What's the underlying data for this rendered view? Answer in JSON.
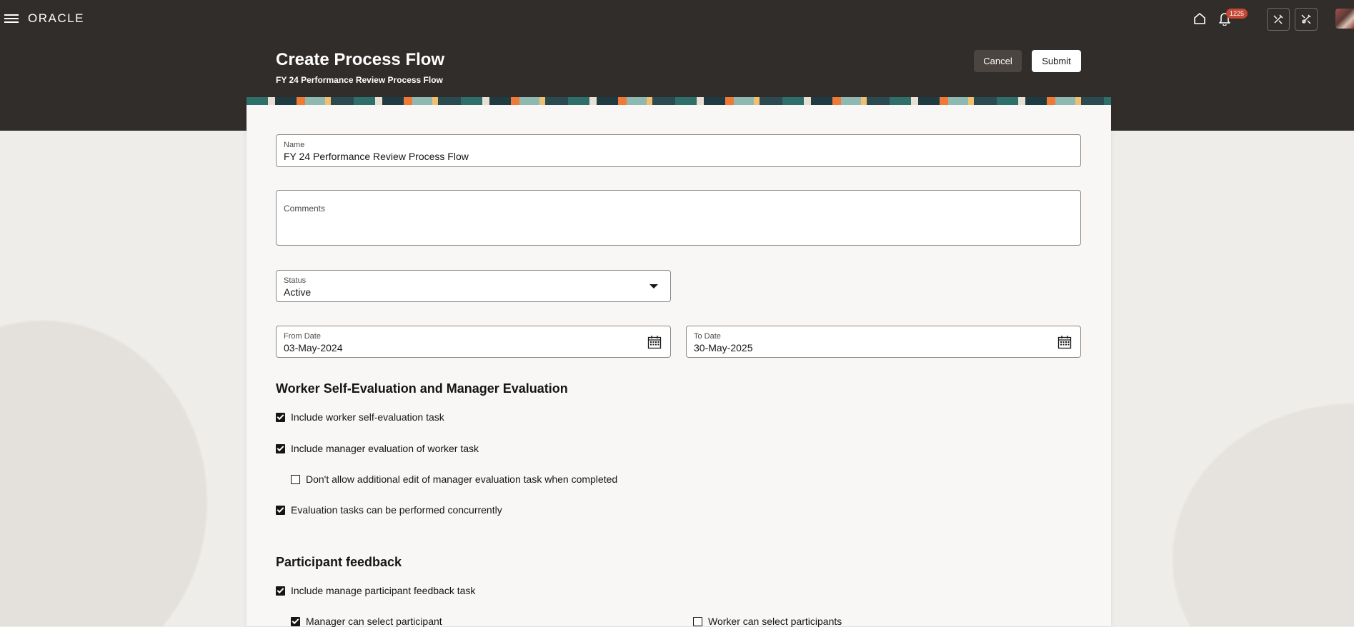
{
  "header": {
    "logo": "ORACLE",
    "notification_count": "1225",
    "title": "Create Process Flow",
    "subtitle": "FY 24 Performance Review Process Flow",
    "cancel_label": "Cancel",
    "submit_label": "Submit"
  },
  "form": {
    "name": {
      "label": "Name",
      "value": "FY 24 Performance Review Process Flow"
    },
    "comments": {
      "label": "Comments",
      "value": ""
    },
    "status": {
      "label": "Status",
      "value": "Active"
    },
    "from_date": {
      "label": "From Date",
      "value": "03-May-2024"
    },
    "to_date": {
      "label": "To Date",
      "value": "30-May-2025"
    }
  },
  "sections": {
    "evaluation": {
      "title": "Worker Self-Evaluation and Manager Evaluation",
      "options": [
        {
          "label": "Include worker self-evaluation task",
          "checked": true
        },
        {
          "label": "Include manager evaluation of worker task",
          "checked": true
        },
        {
          "label": "Don't allow additional edit of manager evaluation task when completed",
          "checked": false
        },
        {
          "label": "Evaluation tasks can be performed concurrently",
          "checked": true
        }
      ]
    },
    "feedback": {
      "title": "Participant feedback",
      "options": [
        {
          "label": "Include manage participant feedback task",
          "checked": true
        },
        {
          "label": "Manager can select participant",
          "checked": true
        },
        {
          "label": "Worker can select participants",
          "checked": false
        }
      ]
    }
  },
  "colors": {
    "header_bg": "#312d2a",
    "badge": "#c74634",
    "page_bg": "#efedea"
  }
}
